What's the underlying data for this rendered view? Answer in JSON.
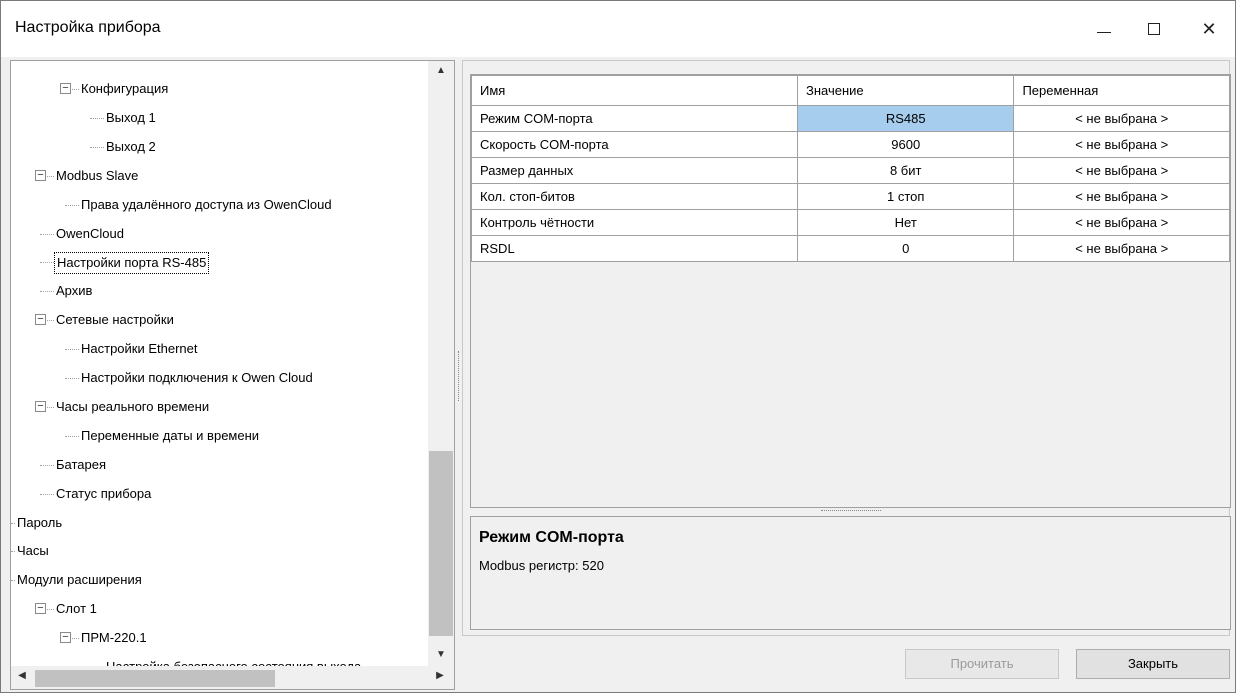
{
  "window": {
    "title": "Настройка прибора"
  },
  "tree": {
    "items": [
      {
        "label": "Конфигурация",
        "level": 2,
        "expander": "−"
      },
      {
        "label": "Выход 1",
        "level": 3
      },
      {
        "label": "Выход 2",
        "level": 3
      },
      {
        "label": "Modbus Slave",
        "level": 1,
        "expander": "−"
      },
      {
        "label": "Права удалённого доступа из OwenCloud",
        "level": 2
      },
      {
        "label": "OwenCloud",
        "level": 1
      },
      {
        "label": "Настройки порта RS-485",
        "level": 1,
        "selected": true
      },
      {
        "label": "Архив",
        "level": 1
      },
      {
        "label": "Сетевые настройки",
        "level": 1,
        "expander": "−"
      },
      {
        "label": "Настройки Ethernet",
        "level": 2
      },
      {
        "label": "Настройки подключения к Owen Cloud",
        "level": 2
      },
      {
        "label": "Часы реального времени",
        "level": 1,
        "expander": "−"
      },
      {
        "label": "Переменные даты и времени",
        "level": 2
      },
      {
        "label": "Батарея",
        "level": 1
      },
      {
        "label": "Статус прибора",
        "level": 1
      },
      {
        "label": "Пароль",
        "level": 0
      },
      {
        "label": "Часы",
        "level": 0
      },
      {
        "label": "Модули расширения",
        "level": 0
      },
      {
        "label": "Слот 1",
        "level": 1,
        "expander": "−"
      },
      {
        "label": "ПРМ-220.1",
        "level": 2,
        "expander": "−"
      },
      {
        "label": "Настройка безопасного состояния выхода",
        "level": 3
      }
    ]
  },
  "grid": {
    "headers": {
      "name": "Имя",
      "value": "Значение",
      "variable": "Переменная"
    },
    "rows": [
      {
        "name": "Режим COM-порта",
        "value": "RS485",
        "variable": "< не выбрана >",
        "selected": true
      },
      {
        "name": "Скорость COM-порта",
        "value": "9600",
        "variable": "< не выбрана >"
      },
      {
        "name": "Размер данных",
        "value": "8 бит",
        "variable": "< не выбрана >"
      },
      {
        "name": "Кол. стоп-битов",
        "value": "1 стоп",
        "variable": "< не выбрана >"
      },
      {
        "name": "Контроль чётности",
        "value": "Нет",
        "variable": "< не выбрана >"
      },
      {
        "name": "RSDL",
        "value": "0",
        "variable": "< не выбрана >"
      }
    ]
  },
  "description": {
    "title": "Режим COM-порта",
    "text": "Modbus регистр: 520"
  },
  "buttons": {
    "read": "Прочитать",
    "close": "Закрыть"
  },
  "colors": {
    "selection": "#a6cdee",
    "disabled_text": "#9a9a9a"
  }
}
